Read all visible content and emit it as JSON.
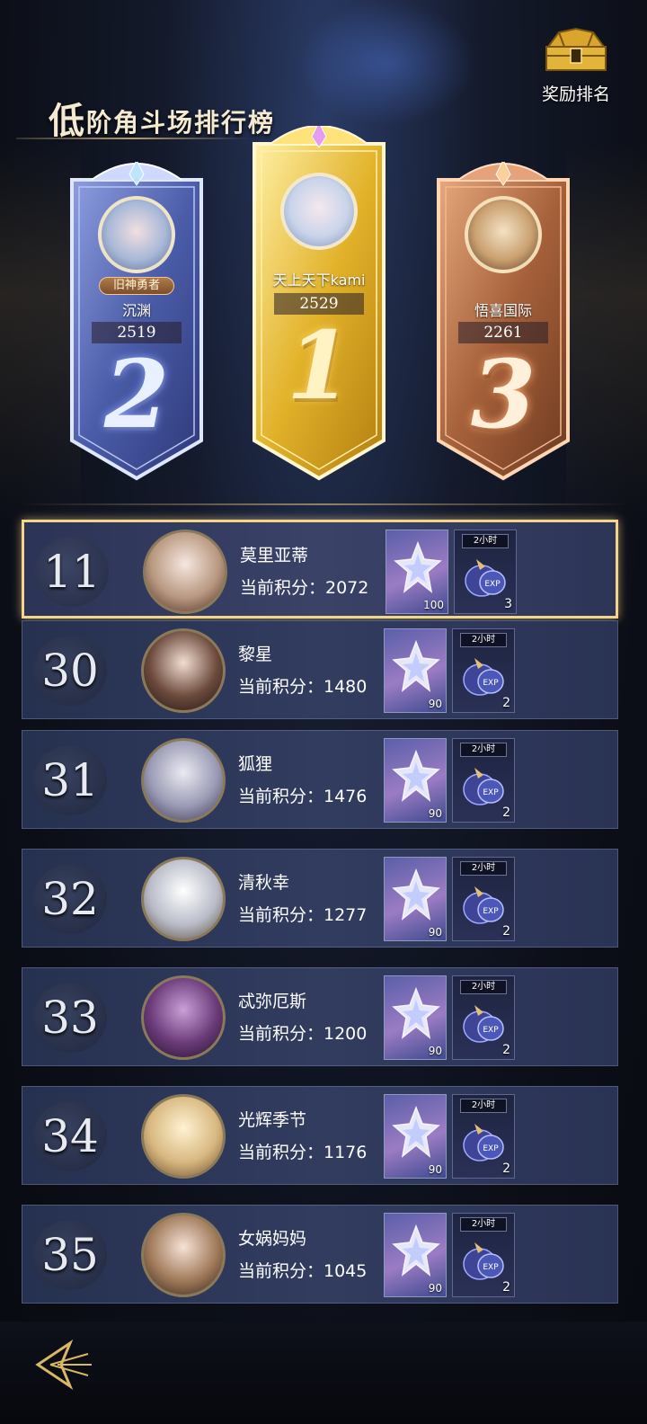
{
  "header": {
    "title_first": "低",
    "title_rest": "阶角斗场排行榜",
    "reward_label": "奖励排名"
  },
  "podium": {
    "second": {
      "name": "沉渊",
      "score": "2519",
      "rank": "2",
      "badge": "旧神勇者"
    },
    "first": {
      "name": "天上天下kami",
      "score": "2529",
      "rank": "1"
    },
    "third": {
      "name": "悟喜国际",
      "score": "2261",
      "rank": "3"
    }
  },
  "list": [
    {
      "rank": "11",
      "name": "莫里亚蒂",
      "score_text": "当前积分：2072",
      "item1_qty": "100",
      "item2_time": "2小时",
      "item2_qty": "3",
      "is_self": true
    },
    {
      "rank": "30",
      "name": "黎星",
      "score_text": "当前积分：1480",
      "item1_qty": "90",
      "item2_time": "2小时",
      "item2_qty": "2",
      "is_self": false
    },
    {
      "rank": "31",
      "name": "狐狸",
      "score_text": "当前积分：1476",
      "item1_qty": "90",
      "item2_time": "2小时",
      "item2_qty": "2",
      "is_self": false
    },
    {
      "rank": "32",
      "name": "清秋幸",
      "score_text": "当前积分：1277",
      "item1_qty": "90",
      "item2_time": "2小时",
      "item2_qty": "2",
      "is_self": false
    },
    {
      "rank": "33",
      "name": "忒弥厄斯",
      "score_text": "当前积分：1200",
      "item1_qty": "90",
      "item2_time": "2小时",
      "item2_qty": "2",
      "is_self": false
    },
    {
      "rank": "34",
      "name": "光辉季节",
      "score_text": "当前积分：1176",
      "item1_qty": "90",
      "item2_time": "2小时",
      "item2_qty": "2",
      "is_self": false
    },
    {
      "rank": "35",
      "name": "女娲妈妈",
      "score_text": "当前积分：1045",
      "item1_qty": "90",
      "item2_time": "2小时",
      "item2_qty": "2",
      "is_self": false
    }
  ],
  "icons": {
    "reward": "treasure-chest-icon",
    "back": "back-arrow-icon",
    "item1": "crystal-star-icon",
    "item2": "exp-potion-icon"
  },
  "colors": {
    "gold": "#f2d58a",
    "silver": "#a9b6e6",
    "bronze": "#c4835a",
    "panel": "#323c5f"
  }
}
